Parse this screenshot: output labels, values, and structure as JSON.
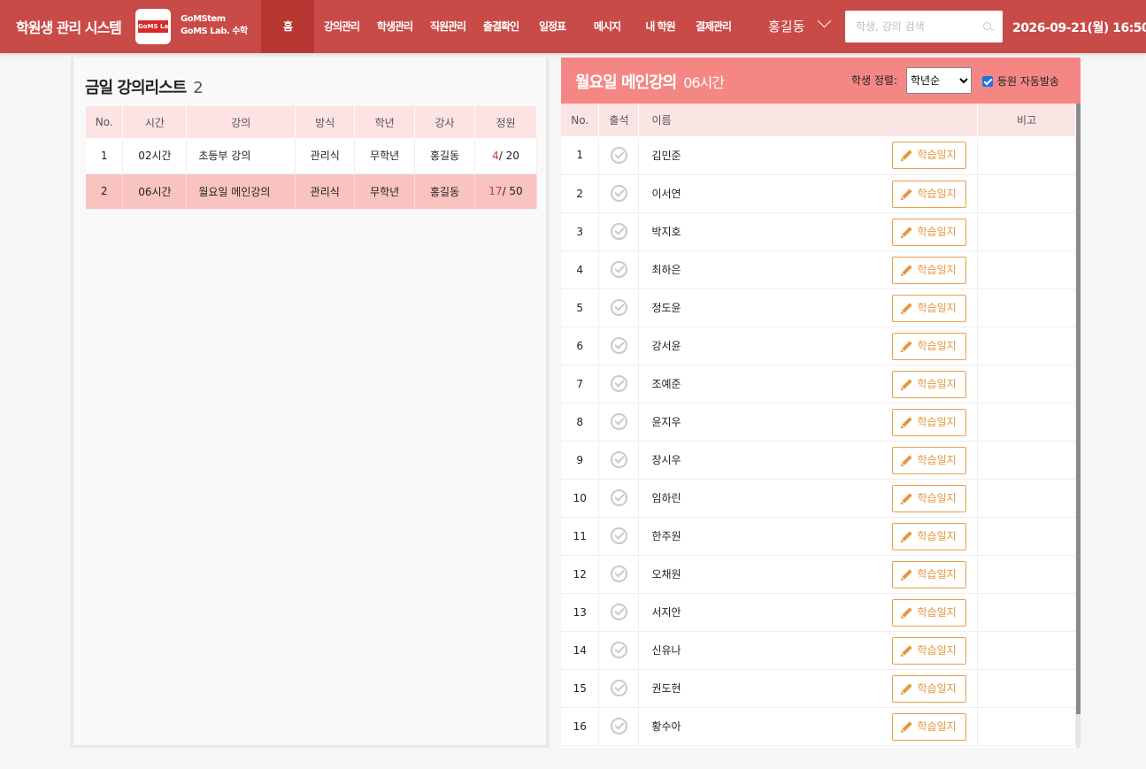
{
  "header": {
    "app_title": "학원생 관리 시스템",
    "logo_text": "GoMS Lab.",
    "brand_line1": "GoMStem",
    "brand_line2": "GoMS Lab. 수학",
    "nav": [
      {
        "label": "홈",
        "active": true
      },
      {
        "label": "강의관리",
        "active": false
      },
      {
        "label": "학생관리",
        "active": false
      },
      {
        "label": "직원관리",
        "active": false
      },
      {
        "label": "출결확인",
        "active": false
      },
      {
        "label": "일정표",
        "active": false
      },
      {
        "label": "메시지",
        "active": false
      },
      {
        "label": "내 학원",
        "active": false
      },
      {
        "label": "결제관리",
        "active": false
      }
    ],
    "user_name": "홍길동",
    "search_placeholder": "학생, 강의 검색",
    "datetime": "2026-09-21(월) 16:50",
    "color_bar": "#c94b47",
    "color_active": "#b83733"
  },
  "lesson_list": {
    "title": "금일 강의리스트",
    "count": "2",
    "columns": [
      "No.",
      "시간",
      "강의",
      "방식",
      "학년",
      "강사",
      "정원"
    ],
    "rows": [
      {
        "no": "1",
        "time": "02시간",
        "name": "초등부 강의",
        "method": "관리식",
        "grade": "무학년",
        "teacher": "홍길동",
        "enrolled": "4",
        "capacity": "/ 20",
        "selected": false
      },
      {
        "no": "2",
        "time": "06시간",
        "name": "월요일 메인강의",
        "method": "관리식",
        "grade": "무학년",
        "teacher": "홍길동",
        "enrolled": "17",
        "capacity": "/ 50",
        "selected": true
      }
    ]
  },
  "lesson_detail": {
    "title": "월요일 메인강의",
    "duration": "06시간",
    "sort_label": "학생 정렬:",
    "sort_options": [
      "학년순"
    ],
    "sort_selected": "학년순",
    "autosend_label": "등원 자동발송",
    "autosend_checked": true,
    "columns": [
      "No.",
      "출석",
      "이름",
      "비고"
    ],
    "diary_label": "학습일지",
    "students": [
      {
        "no": "1",
        "name": "김민준"
      },
      {
        "no": "2",
        "name": "이서연"
      },
      {
        "no": "3",
        "name": "박지호"
      },
      {
        "no": "4",
        "name": "최하은"
      },
      {
        "no": "5",
        "name": "정도윤"
      },
      {
        "no": "6",
        "name": "강서윤"
      },
      {
        "no": "7",
        "name": "조예준"
      },
      {
        "no": "8",
        "name": "윤지우"
      },
      {
        "no": "9",
        "name": "장시우"
      },
      {
        "no": "10",
        "name": "임하린"
      },
      {
        "no": "11",
        "name": "한주원"
      },
      {
        "no": "12",
        "name": "오채원"
      },
      {
        "no": "13",
        "name": "서지안"
      },
      {
        "no": "14",
        "name": "신유나"
      },
      {
        "no": "15",
        "name": "권도현"
      },
      {
        "no": "16",
        "name": "황수아"
      }
    ],
    "color_header": "#f48784",
    "color_diary": "#e8963c"
  }
}
